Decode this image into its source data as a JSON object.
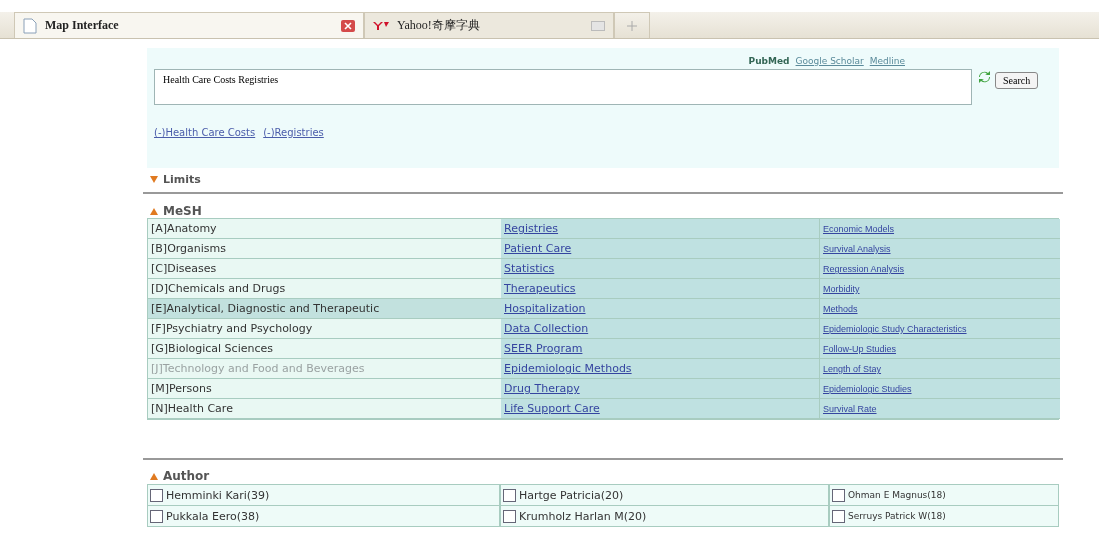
{
  "browser_tabs": [
    {
      "title": "Map Interface",
      "selected": true,
      "kind": "page"
    },
    {
      "title": "Yahoo!奇摩字典",
      "selected": false,
      "kind": "yahoo"
    }
  ],
  "search": {
    "sources": [
      {
        "label": "PubMed",
        "selected": true
      },
      {
        "label": "Google Scholar",
        "selected": false
      },
      {
        "label": "Medline",
        "selected": false
      }
    ],
    "query": "Health Care Costs Registries",
    "button": "Search",
    "terms": [
      "(-)Health Care Costs",
      "(-)Registries"
    ]
  },
  "limits": {
    "label": "Limits",
    "expanded": false
  },
  "mesh": {
    "label": "MeSH",
    "expanded": true,
    "categories": [
      {
        "label": "[A]Anatomy",
        "selected": false,
        "disabled": false
      },
      {
        "label": "[B]Organisms",
        "selected": false,
        "disabled": false
      },
      {
        "label": "[C]Diseases",
        "selected": false,
        "disabled": false
      },
      {
        "label": "[D]Chemicals and Drugs",
        "selected": false,
        "disabled": false
      },
      {
        "label": "[E]Analytical, Diagnostic and Therapeutic",
        "selected": true,
        "disabled": false
      },
      {
        "label": "[F]Psychiatry and Psychology",
        "selected": false,
        "disabled": false
      },
      {
        "label": "[G]Biological Sciences",
        "selected": false,
        "disabled": false
      },
      {
        "label": "[J]Technology and Food and Beverages",
        "selected": false,
        "disabled": true
      },
      {
        "label": "[M]Persons",
        "selected": false,
        "disabled": false
      },
      {
        "label": "[N]Health Care",
        "selected": false,
        "disabled": false
      }
    ],
    "column_2": [
      "Registries",
      "Patient Care",
      "Statistics",
      "Therapeutics",
      "Hospitalization",
      "Data Collection",
      "SEER Program",
      "Epidemiologic Methods",
      "Drug Therapy",
      "Life Support Care"
    ],
    "column_3": [
      "Economic Models",
      "Survival Analysis",
      "Regression Analysis",
      "Morbidity",
      "Methods",
      "Epidemiologic Study Characteristics",
      "Follow-Up Studies",
      "Length of Stay",
      "Epidemiologic Studies",
      "Survival Rate"
    ]
  },
  "author": {
    "label": "Author",
    "expanded": true,
    "authors": [
      {
        "name": "Hemminki Kari(39)",
        "checked": false
      },
      {
        "name": "Hartge Patricia(20)",
        "checked": false
      },
      {
        "name": "Ohman E Magnus(18)",
        "checked": false
      },
      {
        "name": "Pukkala Eero(38)",
        "checked": false
      },
      {
        "name": "Krumholz Harlan M(20)",
        "checked": false
      },
      {
        "name": "Serruys Patrick W(18)",
        "checked": false
      }
    ]
  }
}
